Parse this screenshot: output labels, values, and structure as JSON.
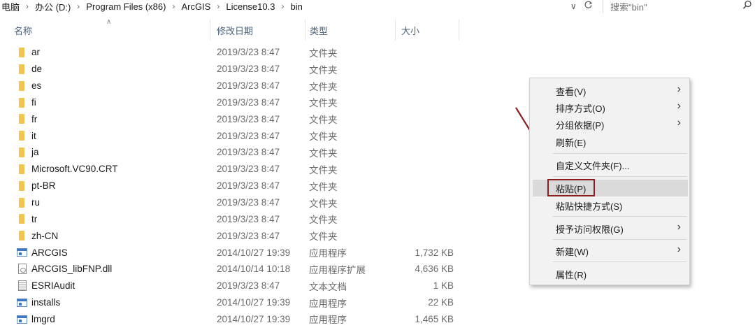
{
  "breadcrumb": [
    "电脑",
    "办公 (D:)",
    "Program Files (x86)",
    "ArcGIS",
    "License10.3",
    "bin"
  ],
  "address_controls": {
    "dropdown_icon": "chevron-down-icon",
    "refresh_icon": "refresh-icon"
  },
  "search": {
    "placeholder": "搜索\"bin\"",
    "icon": "search-icon"
  },
  "columns": {
    "name": "名称",
    "date": "修改日期",
    "type": "类型",
    "size": "大小"
  },
  "files": [
    {
      "name": "ar",
      "date": "2019/3/23 8:47",
      "type": "文件夹",
      "size": "",
      "icon": "folder"
    },
    {
      "name": "de",
      "date": "2019/3/23 8:47",
      "type": "文件夹",
      "size": "",
      "icon": "folder"
    },
    {
      "name": "es",
      "date": "2019/3/23 8:47",
      "type": "文件夹",
      "size": "",
      "icon": "folder"
    },
    {
      "name": "fi",
      "date": "2019/3/23 8:47",
      "type": "文件夹",
      "size": "",
      "icon": "folder"
    },
    {
      "name": "fr",
      "date": "2019/3/23 8:47",
      "type": "文件夹",
      "size": "",
      "icon": "folder"
    },
    {
      "name": "it",
      "date": "2019/3/23 8:47",
      "type": "文件夹",
      "size": "",
      "icon": "folder"
    },
    {
      "name": "ja",
      "date": "2019/3/23 8:47",
      "type": "文件夹",
      "size": "",
      "icon": "folder"
    },
    {
      "name": "Microsoft.VC90.CRT",
      "date": "2019/3/23 8:47",
      "type": "文件夹",
      "size": "",
      "icon": "folder"
    },
    {
      "name": "pt-BR",
      "date": "2019/3/23 8:47",
      "type": "文件夹",
      "size": "",
      "icon": "folder"
    },
    {
      "name": "ru",
      "date": "2019/3/23 8:47",
      "type": "文件夹",
      "size": "",
      "icon": "folder"
    },
    {
      "name": "tr",
      "date": "2019/3/23 8:47",
      "type": "文件夹",
      "size": "",
      "icon": "folder"
    },
    {
      "name": "zh-CN",
      "date": "2019/3/23 8:47",
      "type": "文件夹",
      "size": "",
      "icon": "folder"
    },
    {
      "name": "ARCGIS",
      "date": "2014/10/27 19:39",
      "type": "应用程序",
      "size": "1,732 KB",
      "icon": "app"
    },
    {
      "name": "ARCGIS_libFNP.dll",
      "date": "2014/10/14 10:18",
      "type": "应用程序扩展",
      "size": "4,636 KB",
      "icon": "dll"
    },
    {
      "name": "ESRIAudit",
      "date": "2019/3/23 8:47",
      "type": "文本文档",
      "size": "1 KB",
      "icon": "txt"
    },
    {
      "name": "installs",
      "date": "2014/10/27 19:39",
      "type": "应用程序",
      "size": "22 KB",
      "icon": "app"
    },
    {
      "name": "lmgrd",
      "date": "2014/10/27 19:39",
      "type": "应用程序",
      "size": "1,465 KB",
      "icon": "app"
    }
  ],
  "context_menu": {
    "view": "查看(V)",
    "sort": "排序方式(O)",
    "group": "分组依据(P)",
    "refresh": "刷新(E)",
    "customize": "自定义文件夹(F)...",
    "paste": "粘贴(P)",
    "paste_shortcut": "粘贴快捷方式(S)",
    "grant_access": "授予访问权限(G)",
    "new": "新建(W)",
    "properties": "属性(R)"
  },
  "colors": {
    "highlight_box": "#8b1e1e",
    "arrow": "#8b1e1e",
    "folder": "#f2c450"
  }
}
